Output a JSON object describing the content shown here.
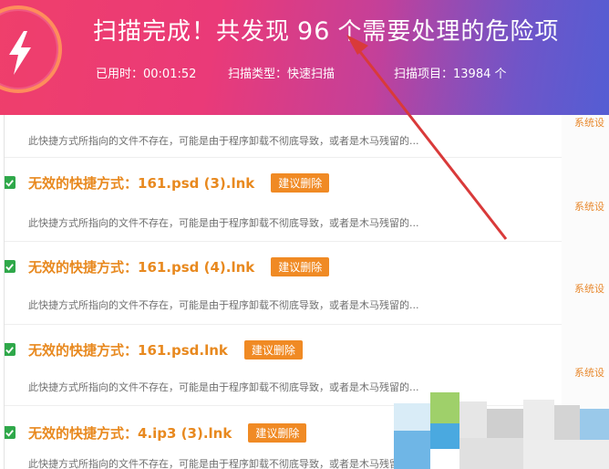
{
  "header": {
    "title_prefix": "扫描完成！共发现",
    "count": "96",
    "title_suffix": "个需要处理的危险项",
    "elapsed": "已用时：00:01:52",
    "scan_type": "扫描类型：快速扫描",
    "scan_items": "扫描项目：13984 个"
  },
  "list": {
    "top_desc": "此快捷方式所指向的文件不存在，可能是由于程序卸载不彻底导致，或者是木马残留的...",
    "items": [
      {
        "title": "无效的快捷方式：161.psd (3).lnk",
        "badge": "建议删除",
        "desc": "此快捷方式所指向的文件不存在，可能是由于程序卸载不彻底导致，或者是木马残留的..."
      },
      {
        "title": "无效的快捷方式：161.psd (4).lnk",
        "badge": "建议删除",
        "desc": "此快捷方式所指向的文件不存在，可能是由于程序卸载不彻底导致，或者是木马残留的..."
      },
      {
        "title": "无效的快捷方式：161.psd.lnk",
        "badge": "建议删除",
        "desc": "此快捷方式所指向的文件不存在，可能是由于程序卸载不彻底导致，或者是木马残留的..."
      },
      {
        "title": "无效的快捷方式：4.ip3 (3).lnk",
        "badge": "建议删除",
        "desc": "此快捷方式所指向的文件不存在，可能是由于程序卸载不彻底导致，或者是木马残留的..."
      }
    ]
  },
  "sidebar": {
    "labels": [
      "系统设",
      "系统设",
      "系统设",
      "系统设"
    ]
  },
  "colors": {
    "accent_orange": "#f08a24",
    "title_orange": "#e8891f",
    "check_green": "#2fa84a",
    "annotation_red": "#d93a3a"
  },
  "icons": {
    "logo": "lightning-bolt-icon",
    "checkbox": "checkmark-icon"
  }
}
